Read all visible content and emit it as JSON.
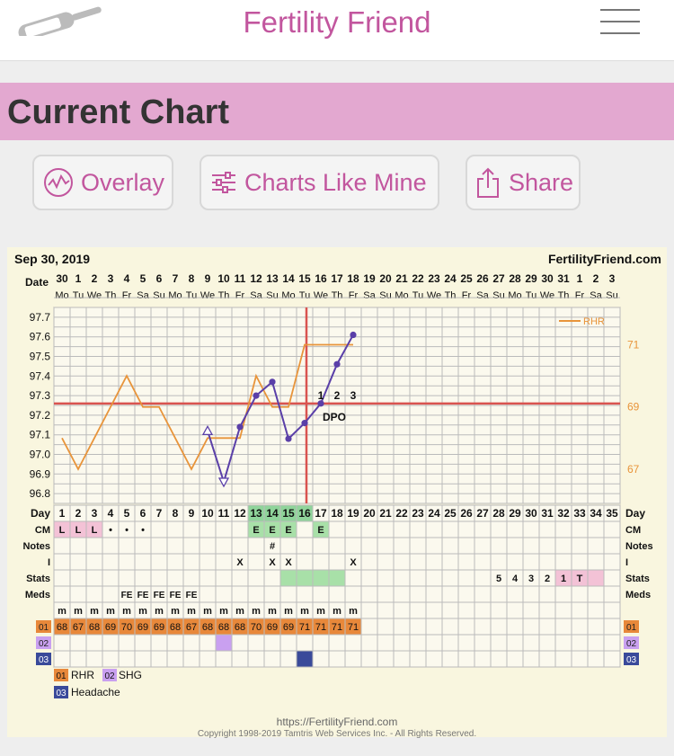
{
  "app": {
    "title": "Fertility Friend"
  },
  "page": {
    "title": "Current Chart"
  },
  "buttons": {
    "overlay": "Overlay",
    "charts_like_mine": "Charts Like Mine",
    "share": "Share"
  },
  "chart_header": {
    "date": "Sep 30, 2019",
    "site": "FertilityFriend.com"
  },
  "labels": {
    "date": "Date",
    "day": "Day",
    "cm": "CM",
    "notes": "Notes",
    "i": "I",
    "stats": "Stats",
    "meds": "Meds",
    "dpo": "DPO",
    "rhr": "RHR"
  },
  "legend": [
    {
      "code": "01",
      "name": "RHR",
      "color": "#e8883a"
    },
    {
      "code": "02",
      "name": "SHG",
      "color": "#c9a0f0"
    },
    {
      "code": "03",
      "name": "Headache",
      "color": "#3a4a9a"
    }
  ],
  "chart_data": {
    "type": "line",
    "dates": [
      "30",
      "1",
      "2",
      "3",
      "4",
      "5",
      "6",
      "7",
      "8",
      "9",
      "10",
      "11",
      "12",
      "13",
      "14",
      "15",
      "16",
      "17",
      "18",
      "19",
      "20",
      "21",
      "22",
      "23",
      "24",
      "25",
      "26",
      "27",
      "28",
      "29",
      "30",
      "31",
      "1",
      "2",
      "3"
    ],
    "weekdays": [
      "Mo",
      "Tu",
      "We",
      "Th",
      "Fr",
      "Sa",
      "Su",
      "Mo",
      "Tu",
      "We",
      "Th",
      "Fr",
      "Sa",
      "Su",
      "Mo",
      "Tu",
      "We",
      "Th",
      "Fr",
      "Sa",
      "Su",
      "Mo",
      "Tu",
      "We",
      "Th",
      "Fr",
      "Sa",
      "Su",
      "Mo",
      "Tu",
      "We",
      "Th",
      "Fr",
      "Sa",
      "Su"
    ],
    "cycle_days": [
      1,
      2,
      3,
      4,
      5,
      6,
      7,
      8,
      9,
      10,
      11,
      12,
      13,
      14,
      15,
      16,
      17,
      18,
      19,
      20,
      21,
      22,
      23,
      24,
      25,
      26,
      27,
      28,
      29,
      30,
      31,
      32,
      33,
      34,
      35
    ],
    "temp_ticks": [
      "97.7",
      "97.6",
      "97.5",
      "97.4",
      "97.3",
      "97.2",
      "97.1",
      "97.0",
      "96.9",
      "96.8"
    ],
    "temp_ylim": [
      96.75,
      97.75
    ],
    "rhr_ticks": [
      "71",
      "69",
      "67"
    ],
    "rhr_ylim": [
      65.9,
      72.2
    ],
    "coverline": 97.26,
    "ovulation_day": 16,
    "dpo_labels": [
      "1",
      "2",
      "3"
    ],
    "temperature": [
      null,
      null,
      null,
      null,
      null,
      null,
      null,
      null,
      null,
      97.12,
      96.86,
      97.14,
      97.3,
      97.37,
      97.08,
      97.16,
      97.26,
      97.46,
      97.61
    ],
    "open_marker_days": [
      10,
      11
    ],
    "series": [
      {
        "name": "RHR",
        "values": [
          68,
          67,
          68,
          69,
          70,
          69,
          69,
          68,
          67,
          68,
          68,
          68,
          70,
          69,
          69,
          71,
          71,
          71,
          71
        ]
      }
    ],
    "cm": [
      "L",
      "L",
      "L",
      "•",
      "•",
      "•",
      "",
      "",
      "",
      "",
      "",
      "",
      "E",
      "E",
      "E",
      "",
      "E",
      "",
      "",
      "",
      "",
      "",
      "",
      "",
      "",
      "",
      "",
      "",
      "",
      "",
      "",
      "",
      "",
      "",
      ""
    ],
    "notes": [
      "",
      "",
      "",
      "",
      "",
      "",
      "",
      "",
      "",
      "",
      "",
      "",
      "",
      "#",
      "",
      "",
      "",
      "",
      "",
      "",
      "",
      "",
      "",
      "",
      "",
      "",
      "",
      "",
      "",
      "",
      "",
      "",
      "",
      "",
      ""
    ],
    "intercourse": [
      "",
      "",
      "",
      "",
      "",
      "",
      "",
      "",
      "",
      "",
      "",
      "X",
      "",
      "X",
      "X",
      "",
      "",
      "",
      "X",
      "",
      "",
      "",
      "",
      "",
      "",
      "",
      "",
      "",
      "",
      "",
      "",
      "",
      "",
      "",
      ""
    ],
    "stats": [
      "",
      "",
      "",
      "",
      "",
      "",
      "",
      "",
      "",
      "",
      "",
      "",
      "",
      "",
      "",
      "",
      "",
      "",
      "",
      "",
      "",
      "",
      "",
      "",
      "",
      "",
      "",
      "5",
      "4",
      "3",
      "2",
      "1",
      "T",
      "",
      ""
    ],
    "meds": [
      "",
      "",
      "",
      "",
      "FE",
      "FE",
      "FE",
      "FE",
      "FE",
      "",
      "",
      "",
      "",
      "",
      "",
      "",
      "",
      "",
      "",
      "",
      "",
      "",
      "",
      "",
      "",
      "",
      "",
      "",
      "",
      "",
      "",
      "",
      "",
      "",
      ""
    ],
    "temp_method": [
      "m",
      "m",
      "m",
      "m",
      "m",
      "m",
      "m",
      "m",
      "m",
      "m",
      "m",
      "m",
      "m",
      "m",
      "m",
      "m",
      "m",
      "m",
      "m",
      "",
      "",
      "",
      "",
      "",
      "",
      "",
      "",
      "",
      "",
      "",
      "",
      "",
      "",
      "",
      ""
    ],
    "shg_days": [
      11
    ],
    "headache_days": [
      16
    ]
  },
  "footer": {
    "url": "https://FertilityFriend.com",
    "copyright": "Copyright 1998-2019 Tamtris Web Services Inc. - All Rights Reserved."
  },
  "colors": {
    "accent": "#c2569e",
    "band": "#e3a8d0",
    "temp_line": "#5a3fa8",
    "rhr_line": "#e8943a",
    "coverline": "#d9534f"
  }
}
